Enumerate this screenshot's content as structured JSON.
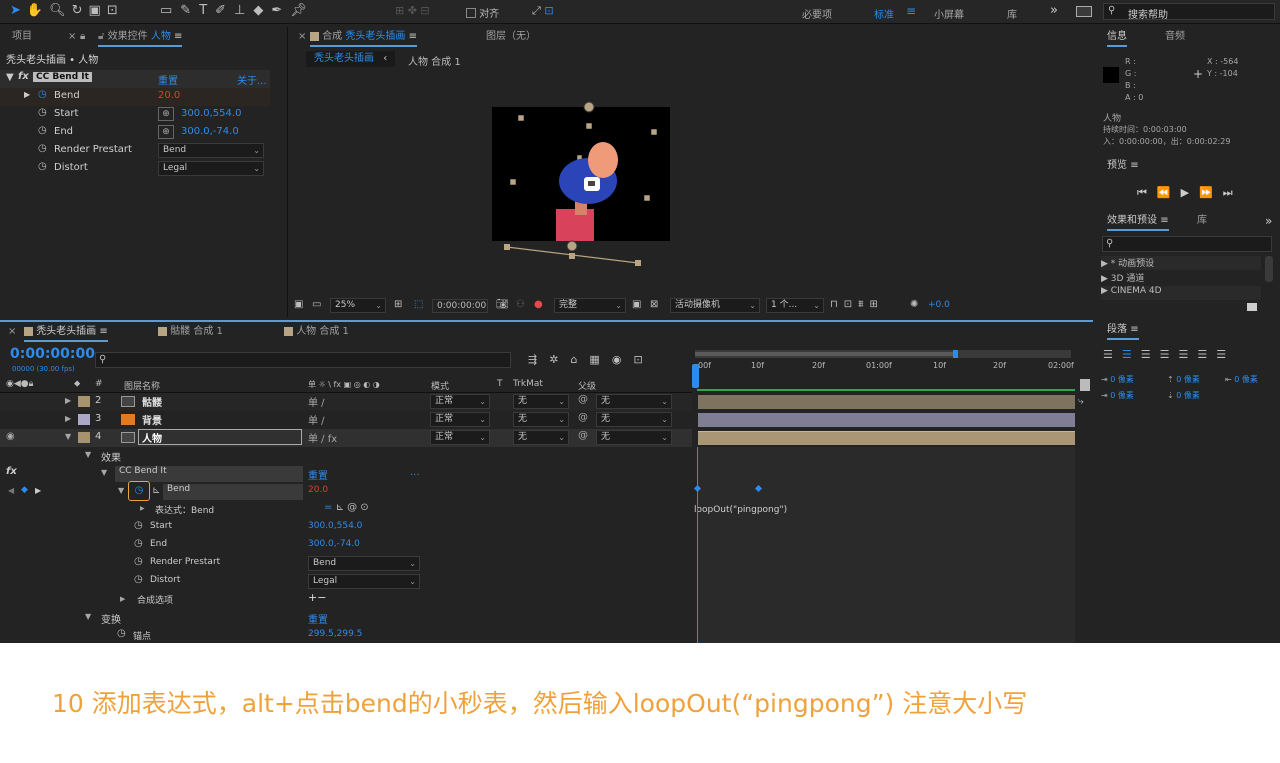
{
  "toolbar": {
    "snap_label": "对齐",
    "workspaces": [
      "必要项",
      "标准",
      "小屏幕",
      "库"
    ],
    "search_placeholder": "搜索帮助",
    "menu_glyph": "≡",
    "more_glyph": "»"
  },
  "project_panel": {
    "tab_project": "项目",
    "tab_effect_controls": "效果控件",
    "tab_effect_target": "人物",
    "breadcrumb": "秃头老头插画 • 人物"
  },
  "effect_controls": {
    "effect_name": "CC Bend It",
    "reset": "重置",
    "about": "关于...",
    "props": [
      {
        "name": "Bend",
        "value": "20.0"
      },
      {
        "name": "Start",
        "value": "300.0,554.0"
      },
      {
        "name": "End",
        "value": "300.0,-74.0"
      },
      {
        "name": "Render Prestart",
        "value": "Bend"
      },
      {
        "name": "Distort",
        "value": "Legal"
      }
    ]
  },
  "composition": {
    "tab_label": "合成",
    "tab_name": "秃头老头插画",
    "layer_tab": "图层（无）",
    "sub_tabs": [
      "秃头老头插画",
      "人物 合成 1"
    ],
    "zoom": "25%",
    "timecode": "0:00:00:00",
    "resolution": "完整",
    "camera": "活动摄像机",
    "views": "1 个...",
    "exposure": "+0.0"
  },
  "info_panel": {
    "tab_info": "信息",
    "tab_audio": "音频",
    "rgba": [
      "R :",
      "G :",
      "B :",
      "A : 0"
    ],
    "x": "X : -564",
    "y": "Y : -104",
    "layer_name": "人物",
    "duration": "持续时间：0:00:03:00",
    "inout": "入：0:00:00:00，出：0:00:02:29"
  },
  "preview_panel": {
    "title": "预览"
  },
  "effects_presets": {
    "title": "效果和预设",
    "tab_lib": "库",
    "search_placeholder": "",
    "items": [
      "* 动画预设",
      "3D 通道",
      "CINEMA 4D"
    ]
  },
  "paragraph_panel": {
    "title": "段落",
    "indent_values": [
      "0 像素",
      "0 像素",
      "0 像素",
      "0 像素",
      "0 像素"
    ]
  },
  "timeline": {
    "tabs": [
      "秃头老头插画",
      "骷髅 合成 1",
      "人物 合成 1"
    ],
    "timecode": "0:00:00:00",
    "fps": "00000 (30.00 fps)",
    "col_headers": {
      "num": "#",
      "source": "图层名称",
      "switches": "单 ☼ \\ fx ▣ ◎ ◐ ◑",
      "mode": "模式",
      "t": "T",
      "trkmat": "TrkMat",
      "parent": "父级"
    },
    "ruler": [
      "00f",
      "10f",
      "20f",
      "01:00f",
      "10f",
      "20f",
      "02:00f"
    ],
    "layers": [
      {
        "num": "2",
        "name": "骷髅",
        "mode": "正常",
        "trk": "无",
        "parent": "无",
        "color": "#a7946f"
      },
      {
        "num": "3",
        "name": "背景",
        "mode": "正常",
        "trk": "无",
        "parent": "无",
        "color": "#a9a8c6"
      },
      {
        "num": "4",
        "name": "人物",
        "mode": "正常",
        "trk": "无",
        "parent": "无",
        "color": "#a7946f"
      }
    ],
    "tree": {
      "effects": "效果",
      "effect_name": "CC Bend It",
      "reset": "重置",
      "dots": "...",
      "bend": "Bend",
      "bend_value": "20.0",
      "expr_label": "表达式：Bend",
      "expression": "loopOut(\"pingpong\")",
      "props": [
        {
          "name": "Start",
          "value": "300.0,554.0"
        },
        {
          "name": "End",
          "value": "300.0,-74.0"
        },
        {
          "name": "Render Prestart",
          "value": "Bend"
        },
        {
          "name": "Distort",
          "value": "Legal"
        }
      ],
      "comp_options": "合成选项",
      "plusminus": "+−",
      "transform": "变换",
      "transform_reset": "重置",
      "anchor": "锚点",
      "anchor_value": "299.5,299.5"
    }
  },
  "caption": "10 添加表达式，alt+点击bend的小秒表，然后输入loopOut(“pingpong”) 注意大小写",
  "colors": {
    "accent": "#2d8ceb",
    "value_red": "#d9412c",
    "caption": "#f0a23a",
    "bg": "#232323"
  }
}
